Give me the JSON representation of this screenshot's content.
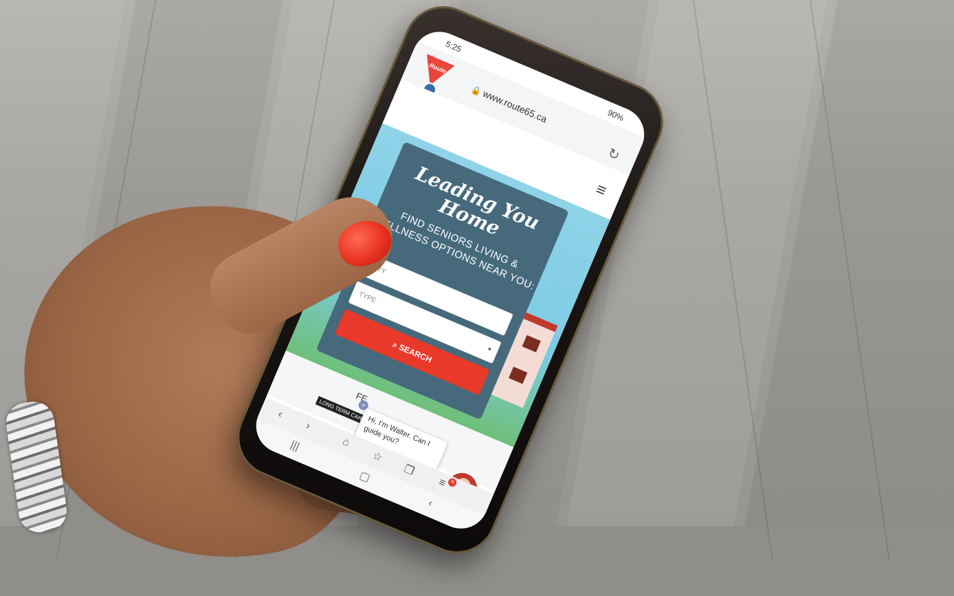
{
  "status": {
    "time": "5:25",
    "battery": "90%"
  },
  "browser": {
    "url": "www.route65.ca"
  },
  "logo": {
    "text": "Route"
  },
  "hero": {
    "title": "Leading You Home",
    "subtitle": "FIND SENIORS LIVING & WELLNESS OPTIONS NEAR YOU:",
    "city_placeholder": "CITY",
    "type_placeholder": "TYPE",
    "search_label": "SEARCH"
  },
  "below": {
    "partial_heading": "FE",
    "tag": "LONG TERM CARE"
  },
  "chat": {
    "message": "Hi, I'm Walter. Can I guide you?",
    "close": "×"
  },
  "badges": {
    "menu_badge": "N"
  },
  "colors": {
    "accent_red": "#e8392b",
    "card_blue": "#466a7c",
    "sky": "#8fd3e8"
  },
  "icons": {
    "star": "star-icon",
    "lock": "lock-icon",
    "reload": "reload-icon",
    "menu": "hamburger-menu-icon",
    "search": "search-icon"
  }
}
